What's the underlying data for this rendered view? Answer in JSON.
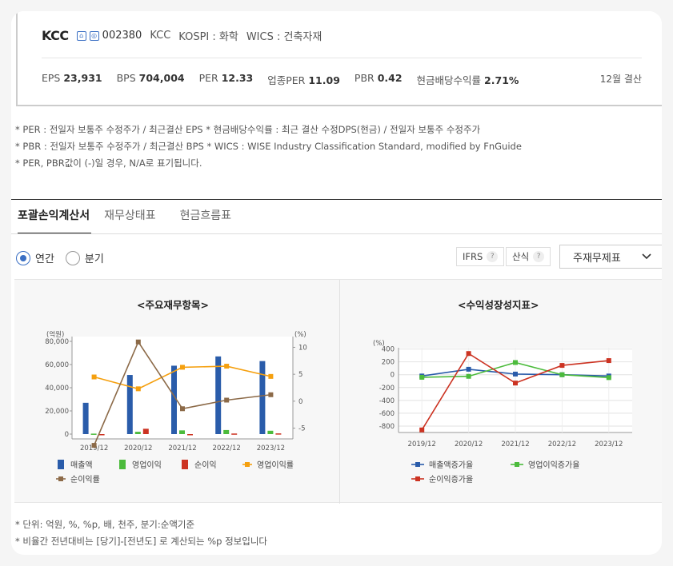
{
  "company": {
    "name": "KCC",
    "code": "002380",
    "ticker": "KCC",
    "market": "KOSPI : 화학",
    "wics": "WICS : 건축자재",
    "settlement": "12월 결산"
  },
  "metrics": [
    {
      "label": "EPS",
      "value": "23,931"
    },
    {
      "label": "BPS",
      "value": "704,004"
    },
    {
      "label": "PER",
      "value": "12.33"
    },
    {
      "label": "업종PER",
      "value": "11.09"
    },
    {
      "label": "PBR",
      "value": "0.42"
    },
    {
      "label": "현금배당수익률",
      "value": "2.71%"
    }
  ],
  "notes": [
    "* PER : 전일자 보통주 수정주가 / 최근결산 EPS * 현금배당수익률 : 최근 결산 수정DPS(현금) / 전일자 보통주 수정주가",
    "* PBR : 전일자 보통주 수정주가 / 최근결산 BPS * WICS : WISE Industry Classification Standard, modified by FnGuide",
    "* PER, PBR값이 (-)일 경우, N/A로 표기됩니다."
  ],
  "tabs": [
    "포괄손익계산서",
    "재무상태표",
    "현금흐름표"
  ],
  "options": {
    "annual": "연간",
    "quarter": "분기",
    "ifrs": "IFRS",
    "calc": "산식",
    "help": "?",
    "select_value": "주재무제표"
  },
  "colors": {
    "blue": "#2a5caa",
    "green": "#4cbb3c",
    "red": "#cc3322",
    "orange": "#f5a00f",
    "brown": "#8c6a48",
    "accent": "#3a6fc4"
  },
  "chart_data": [
    {
      "type": "bar",
      "title": "<주요재무항목>",
      "categories": [
        "2019/12",
        "2020/12",
        "2021/12",
        "2022/12",
        "2023/12"
      ],
      "left_unit": "(억원)",
      "right_unit": "(%)",
      "ylim": [
        0,
        80000
      ],
      "y2lim": [
        -7,
        12
      ],
      "yticks": [
        "0",
        "20,000",
        "40,000",
        "60,000",
        "80,000"
      ],
      "y2ticks": [
        "-5",
        "0",
        "5",
        "10"
      ],
      "series": [
        {
          "name": "매출액",
          "kind": "bar",
          "axis": "left",
          "values": [
            27000,
            51000,
            59000,
            67000,
            63000
          ]
        },
        {
          "name": "영업이익",
          "kind": "bar",
          "axis": "left",
          "values": [
            400,
            2000,
            3200,
            3500,
            2900
          ]
        },
        {
          "name": "순이익",
          "kind": "bar",
          "axis": "left",
          "values": [
            -800,
            4600,
            -300,
            500,
            600
          ]
        },
        {
          "name": "영업이익률",
          "kind": "line",
          "axis": "right",
          "values": [
            4.5,
            2.3,
            6.3,
            6.5,
            4.6
          ]
        },
        {
          "name": "순이익률",
          "kind": "line",
          "axis": "right",
          "values": [
            -8.2,
            11.0,
            -1.4,
            0.2,
            1.2
          ]
        }
      ]
    },
    {
      "type": "line",
      "title": "<수익성장성지표>",
      "categories": [
        "2019/12",
        "2020/12",
        "2021/12",
        "2022/12",
        "2023/12"
      ],
      "unit": "(%)",
      "ylim": [
        -900,
        420
      ],
      "yticks": [
        "-800",
        "-600",
        "-400",
        "-200",
        "0",
        "200",
        "400"
      ],
      "series": [
        {
          "name": "매출액증가율",
          "values": [
            -20,
            85,
            10,
            0,
            -20
          ]
        },
        {
          "name": "영업이익증가율",
          "values": [
            -40,
            -25,
            190,
            0,
            -45
          ]
        },
        {
          "name": "순이익증가율",
          "values": [
            -860,
            330,
            -130,
            145,
            220
          ]
        }
      ]
    }
  ],
  "footer_notes": [
    "* 단위: 억원, %, %p, 배, 천주, 분기:순액기준",
    "* 비율간 전년대비는 [당기]-[전년도] 로 계산되는 %p 정보입니다"
  ]
}
